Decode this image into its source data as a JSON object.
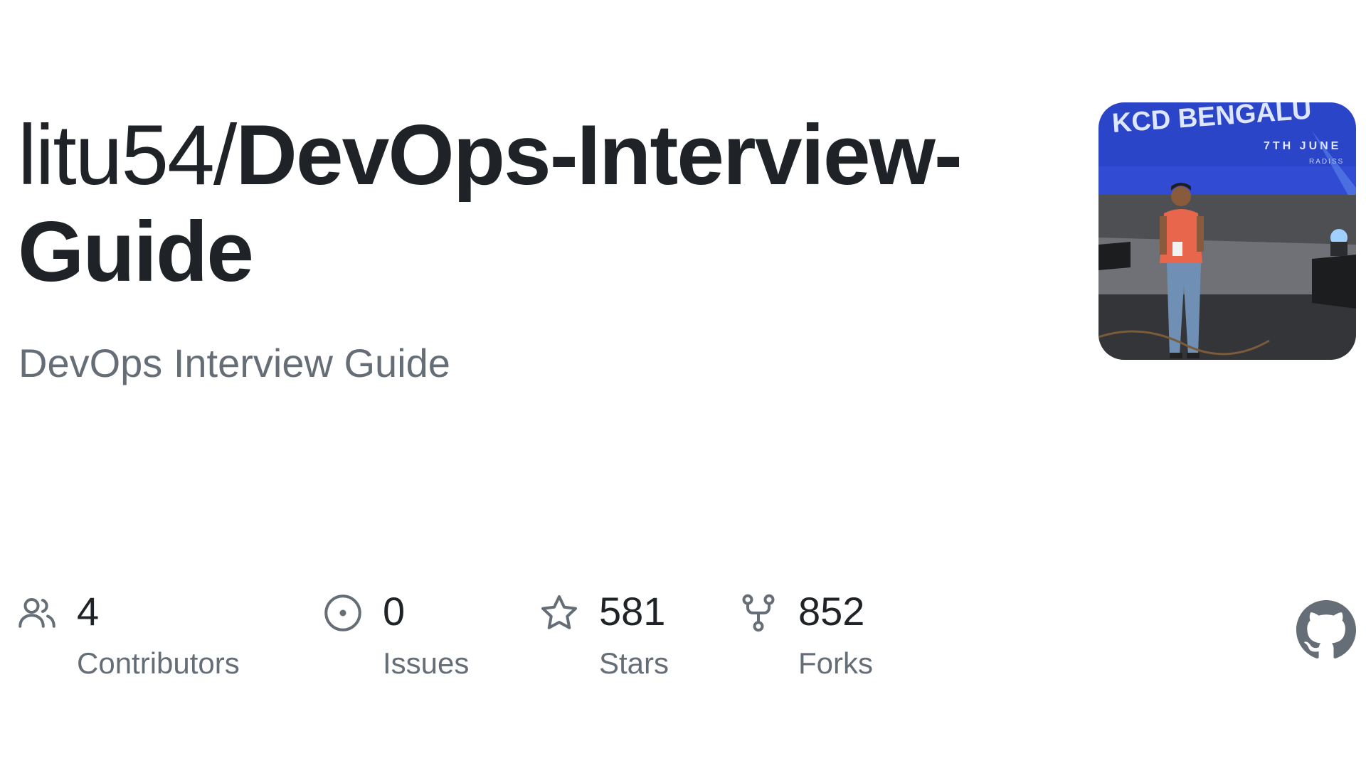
{
  "repo": {
    "owner": "litu54/",
    "name": "DevOps-Interview-Guide",
    "description": "DevOps Interview Guide"
  },
  "avatar": {
    "banner_text": "KCD BENGALU",
    "banner_date": "7TH JUNE",
    "banner_venue": "RADISS"
  },
  "stats": {
    "contributors": {
      "count": "4",
      "label": "Contributors",
      "icon": "people-icon"
    },
    "issues": {
      "count": "0",
      "label": "Issues",
      "icon": "issue-opened-icon"
    },
    "stars": {
      "count": "581",
      "label": "Stars",
      "icon": "star-icon"
    },
    "forks": {
      "count": "852",
      "label": "Forks",
      "icon": "repo-forked-icon"
    }
  },
  "colors": {
    "text_primary": "#1f2328",
    "text_muted": "#656d76",
    "icon": "#656d76",
    "background": "#ffffff"
  }
}
